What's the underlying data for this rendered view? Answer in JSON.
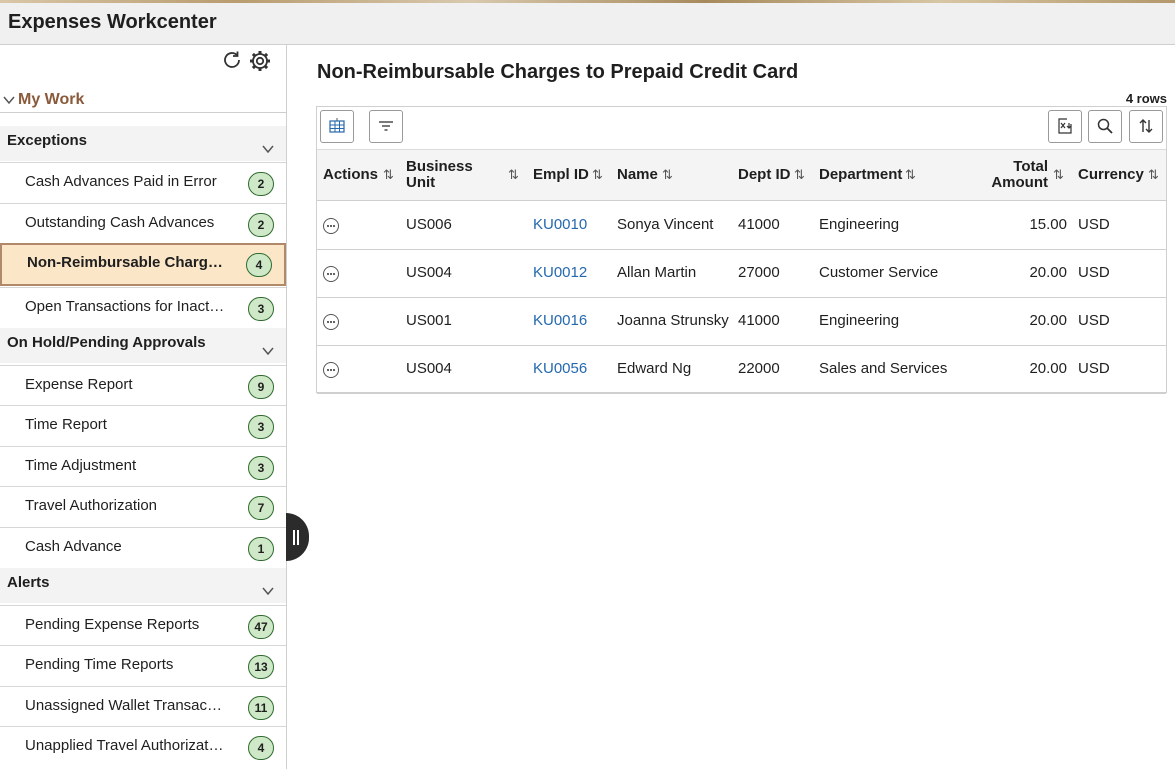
{
  "app": {
    "title": "Expenses Workcenter"
  },
  "sidebar": {
    "refresh_icon": "refresh-icon",
    "settings_icon": "gear-icon",
    "mywork_label": "My Work",
    "groups": [
      {
        "title": "Exceptions",
        "items": [
          {
            "label": "Cash Advances Paid in Error",
            "count": "2"
          },
          {
            "label": "Outstanding Cash Advances",
            "count": "2"
          },
          {
            "label": "Non-Reimbursable Charges to Prepaid Credit Card",
            "count": "4"
          },
          {
            "label": "Open Transactions for Inactive Employees",
            "count": "3"
          }
        ]
      },
      {
        "title": "On Hold/Pending Approvals",
        "items": [
          {
            "label": "Expense Report",
            "count": "9"
          },
          {
            "label": "Time Report",
            "count": "3"
          },
          {
            "label": "Time Adjustment",
            "count": "3"
          },
          {
            "label": "Travel Authorization",
            "count": "7"
          },
          {
            "label": "Cash Advance",
            "count": "1"
          }
        ]
      },
      {
        "title": "Alerts",
        "items": [
          {
            "label": "Pending Expense Reports",
            "count": "47"
          },
          {
            "label": "Pending Time Reports",
            "count": "13"
          },
          {
            "label": "Unassigned Wallet Transactions",
            "count": "11"
          },
          {
            "label": "Unapplied Travel Authorization",
            "count": "4"
          }
        ]
      }
    ]
  },
  "main": {
    "title": "Non-Reimbursable Charges to Prepaid Credit Card",
    "row_count": "4 rows",
    "columns": {
      "actions": "Actions",
      "business_unit_1": "Business",
      "business_unit_2": "Unit",
      "empl_id": "Empl ID",
      "name": "Name",
      "dept_id": "Dept ID",
      "department": "Department",
      "total_amount_1": "Total",
      "total_amount_2": "Amount",
      "currency": "Currency"
    },
    "rows": [
      {
        "business_unit": "US006",
        "empl_id": "KU0010",
        "name": "Sonya Vincent",
        "dept_id": "41000",
        "department": "Engineering",
        "total_amount": "15.00",
        "currency": "USD"
      },
      {
        "business_unit": "US004",
        "empl_id": "KU0012",
        "name": "Allan Martin",
        "dept_id": "27000",
        "department": "Customer Service",
        "total_amount": "20.00",
        "currency": "USD"
      },
      {
        "business_unit": "US001",
        "empl_id": "KU0016",
        "name": "Joanna Strunsky",
        "dept_id": "41000",
        "department": "Engineering",
        "total_amount": "20.00",
        "currency": "USD"
      },
      {
        "business_unit": "US004",
        "empl_id": "KU0056",
        "name": "Edward Ng",
        "dept_id": "22000",
        "department": "Sales and Services",
        "total_amount": "20.00",
        "currency": "USD"
      }
    ]
  },
  "colors": {
    "accent": "#8a5a3a",
    "link": "#2468ae",
    "selected_bg": "#fbe6c8",
    "badge_bg": "#cfe9c8"
  }
}
